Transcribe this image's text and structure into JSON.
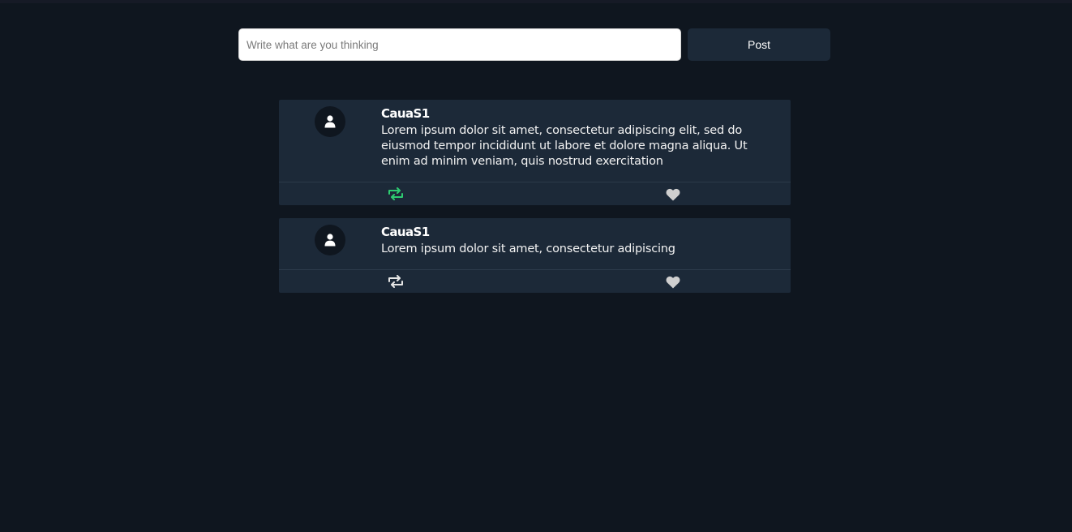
{
  "composer": {
    "placeholder": "Write what are you thinking",
    "value": "",
    "post_label": "Post"
  },
  "colors": {
    "background": "#0f161f",
    "card": "#1c2938",
    "retweet_active": "#2ecc71",
    "retweet_inactive": "#e6e6e6",
    "heart": "#cfcfcf"
  },
  "posts": [
    {
      "avatar_icon": "user-icon",
      "user": "CauaS1",
      "text": "Lorem ipsum dolor sit amet, consectetur adipiscing elit, sed do eiusmod tempor incididunt ut labore et dolore magna aliqua. Ut enim ad minim veniam, quis nostrud exercitation",
      "retweeted": true,
      "liked": false
    },
    {
      "avatar_icon": "user-icon",
      "user": "CauaS1",
      "text": "Lorem ipsum dolor sit amet, consectetur adipiscing",
      "retweeted": false,
      "liked": false
    }
  ]
}
